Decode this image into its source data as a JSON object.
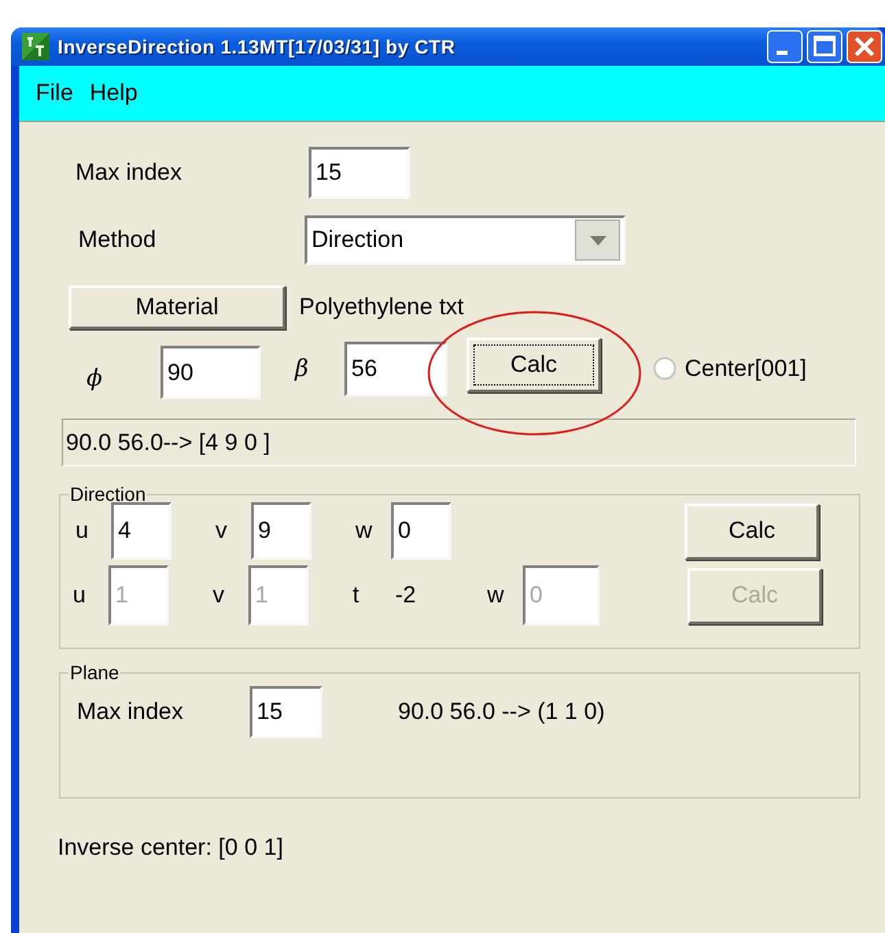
{
  "window": {
    "title": "InverseDirection 1.13MT[17/03/31] by CTR"
  },
  "menu": [
    "File",
    "Help"
  ],
  "max_index": {
    "label": "Max index",
    "value": "15"
  },
  "method": {
    "label": "Method",
    "value": "Direction"
  },
  "material": {
    "button": "Material",
    "file": "Polyethylene txt"
  },
  "angles": [
    {
      "symbol": "ϕ",
      "value": "90"
    },
    {
      "symbol": "β",
      "value": "56"
    }
  ],
  "calc_button": {
    "label": "Calc",
    "circled": true
  },
  "center_option": {
    "label": "Center[001]",
    "selected": false
  },
  "result": "90.0 56.0--> [4 9 0 ]",
  "direction": {
    "title": "Direction",
    "rows": [
      {
        "fields": [
          {
            "kind": "input",
            "label": "u",
            "value": "4",
            "disabled": false
          },
          {
            "kind": "input",
            "label": "v",
            "value": "9",
            "disabled": false
          },
          {
            "kind": "input",
            "label": "w",
            "value": "0",
            "disabled": false
          }
        ],
        "button": {
          "label": "Calc",
          "disabled": false
        }
      },
      {
        "fields": [
          {
            "kind": "input",
            "label": "u",
            "value": "1",
            "disabled": true
          },
          {
            "kind": "input",
            "label": "v",
            "value": "1",
            "disabled": true
          },
          {
            "kind": "text",
            "label": "t",
            "value": "-2"
          },
          {
            "kind": "input",
            "label": "w",
            "value": "0",
            "disabled": true
          }
        ],
        "button": {
          "label": "Calc",
          "disabled": true
        }
      }
    ]
  },
  "plane": {
    "title": "Plane",
    "label": "Max index",
    "value": "15",
    "result": "90.0 56.0 --> (1 1 0)"
  },
  "status": "Inverse center: [0 0 1]"
}
